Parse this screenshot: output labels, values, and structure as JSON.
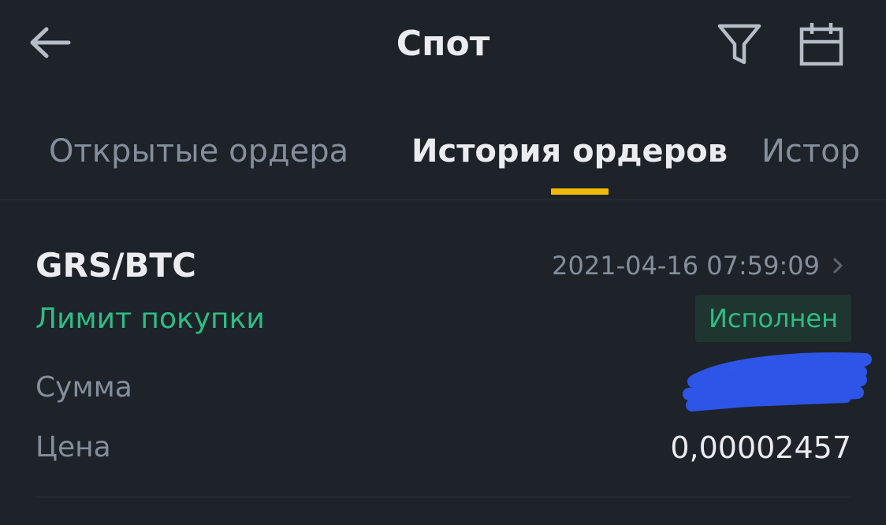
{
  "header": {
    "title": "Спот",
    "back_icon": "arrow-left-icon",
    "filter_icon": "filter-icon",
    "calendar_icon": "calendar-icon"
  },
  "tabs": [
    {
      "label": "Открытые ордера",
      "active": false
    },
    {
      "label": "История ордеров",
      "active": true
    },
    {
      "label": "История сделок",
      "active": false
    }
  ],
  "order": {
    "pair": "GRS/BTC",
    "time": "2021-04-16 07:59:09",
    "side": "Лимит покупки",
    "status": "Исполнен",
    "sum_label": "Сумма",
    "sum_value_redacted": true,
    "price_label": "Цена",
    "price_value": "0,00002457"
  },
  "colors": {
    "background": "#1e2329",
    "accent": "#f0b90b",
    "buy": "#2ebd85",
    "muted_text": "#848e9c",
    "primary_text": "#eaecef",
    "redaction": "#2d55e8"
  }
}
